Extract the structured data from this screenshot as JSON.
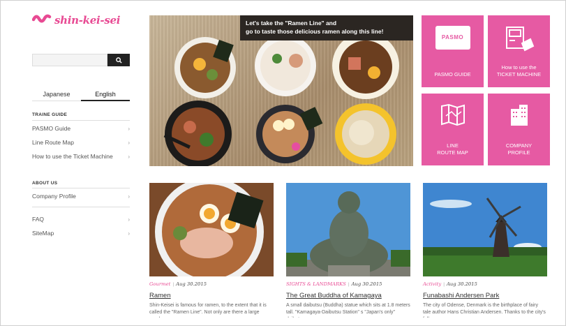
{
  "brand": {
    "name": "shin-kei-sei",
    "color": "#e84a93"
  },
  "search": {
    "placeholder": "",
    "button_icon": "search-icon"
  },
  "languages": [
    {
      "label": "Japanese",
      "active": false
    },
    {
      "label": "English",
      "active": true
    }
  ],
  "sidebar": {
    "guide_title": "TRAINE GUIDE",
    "guide_items": [
      {
        "label": "PASMO Guide"
      },
      {
        "label": "Line Route Map"
      },
      {
        "label": "How to use the Ticket Machine"
      }
    ],
    "about_title": "ABOUT US",
    "about_items": [
      {
        "label": "Company Profile"
      }
    ],
    "extra_items": [
      {
        "label": "FAQ"
      },
      {
        "label": "SiteMap"
      }
    ]
  },
  "hero": {
    "caption_line1": "Let's take the \"Ramen Line\" and",
    "caption_line2": "go to taste those delicious ramen along this line!"
  },
  "tiles": [
    {
      "icon": "pasmo-card-icon",
      "badge": "PASMO",
      "label_line1": "PASMO GUIDE",
      "label_line2": ""
    },
    {
      "icon": "ticket-machine-icon",
      "label_line1": "How to use the",
      "label_line2": "TICKET MACHINE"
    },
    {
      "icon": "route-map-icon",
      "label_line1": "LINE",
      "label_line2": "ROUTE MAP"
    },
    {
      "icon": "building-icon",
      "label_line1": "COMPANY",
      "label_line2": "PROFILE"
    }
  ],
  "tile_color": "#e65aa3",
  "cards": [
    {
      "category": "Gourmet",
      "date": "Aug 30.2015",
      "title": "Ramen",
      "desc": "Shin-Keisei is famous for ramen, to the extent that it is called the \"Ramen Line\". Not only are there a large number"
    },
    {
      "category": "SIGHTS & LANDMARKS",
      "date": "Aug 30.2015",
      "title": "The Great Buddha of Kamagaya",
      "desc": "A small daibutsu (Buddha) statue which sits at 1.8 meters tall. \"Kamagaya-Daibutsu Station\" s \"Japan's only\" daibuts"
    },
    {
      "category": "Activity",
      "date": "Aug 30.2015",
      "title": "Funabashi Andersen Park",
      "desc": "The city of Odense, Denmark is the birthplace of fairy tale author Hans Christian Andersen. Thanks to the city's full"
    }
  ]
}
